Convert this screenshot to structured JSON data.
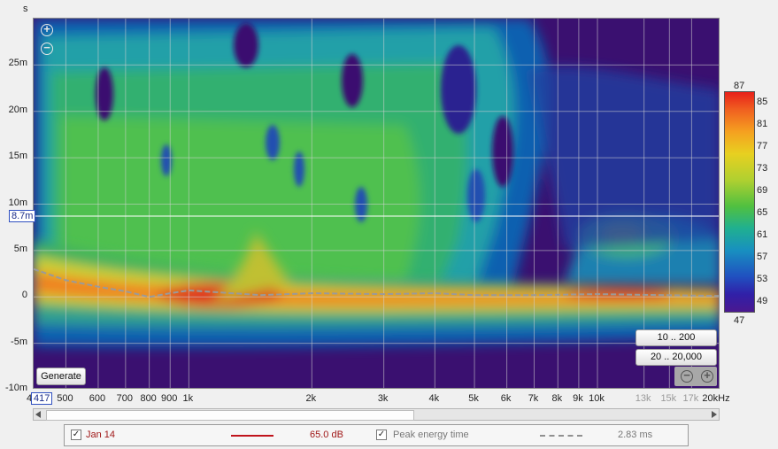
{
  "y_axis": {
    "unit_label": "s",
    "ticks": [
      "25m",
      "20m",
      "15m",
      "10m",
      "5m",
      "0",
      "-5m",
      "-10m"
    ],
    "cursor_value": "8.7m"
  },
  "x_axis": {
    "ticks": [
      "500",
      "600",
      "700",
      "800",
      "900",
      "1k",
      "2k",
      "3k",
      "4k",
      "5k",
      "6k",
      "7k",
      "8k",
      "9k",
      "10k",
      "13k",
      "15k",
      "17k",
      "20kHz"
    ],
    "dim_ticks": [
      "13k",
      "15k",
      "17k"
    ],
    "left_edge_label": "4",
    "cursor_value": "417"
  },
  "colorbar": {
    "top": "87",
    "bottom": "47",
    "ticks": [
      "85",
      "81",
      "77",
      "73",
      "69",
      "65",
      "61",
      "57",
      "53",
      "49"
    ]
  },
  "buttons": {
    "generate": "Generate",
    "range_1": "10 .. 200",
    "range_2": "20 .. 20,000"
  },
  "legend": {
    "series_name": "Jan 14",
    "series_color": "#c0141c",
    "series_value": "65.0 dB",
    "peak_label": "Peak energy time",
    "peak_value": "2.83 ms",
    "peak_color": "#909090"
  },
  "chart_data": {
    "type": "heatmap",
    "title": "",
    "xlabel": "kHz",
    "ylabel": "s",
    "x_scale": "log",
    "xlim": [
      417,
      20000
    ],
    "ylim": [
      -0.01,
      0.03
    ],
    "zlim": [
      47,
      87
    ],
    "grid": true,
    "colorbar_placement": "right",
    "peak_energy_time": {
      "x": [
        417,
        500,
        600,
        700,
        800,
        900,
        1000,
        1500,
        2000,
        3000,
        4000,
        5000,
        7000,
        10000,
        20000
      ],
      "y": [
        0.003,
        0.0018,
        0.0011,
        0.0006,
        0.0,
        0.0004,
        0.0007,
        0.0002,
        0.0004,
        0.0003,
        0.0004,
        0.0002,
        0.0002,
        0.0003,
        0.0001
      ]
    }
  }
}
